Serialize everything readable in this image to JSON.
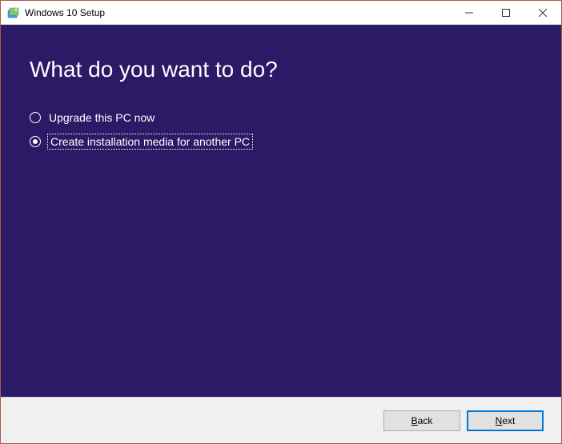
{
  "window": {
    "title": "Windows 10 Setup"
  },
  "main": {
    "heading": "What do you want to do?",
    "options": [
      {
        "label": "Upgrade this PC now",
        "selected": false
      },
      {
        "label": "Create installation media for another PC",
        "selected": true
      }
    ]
  },
  "footer": {
    "back_prefix": "B",
    "back_rest": "ack",
    "next_prefix": "N",
    "next_rest": "ext"
  }
}
